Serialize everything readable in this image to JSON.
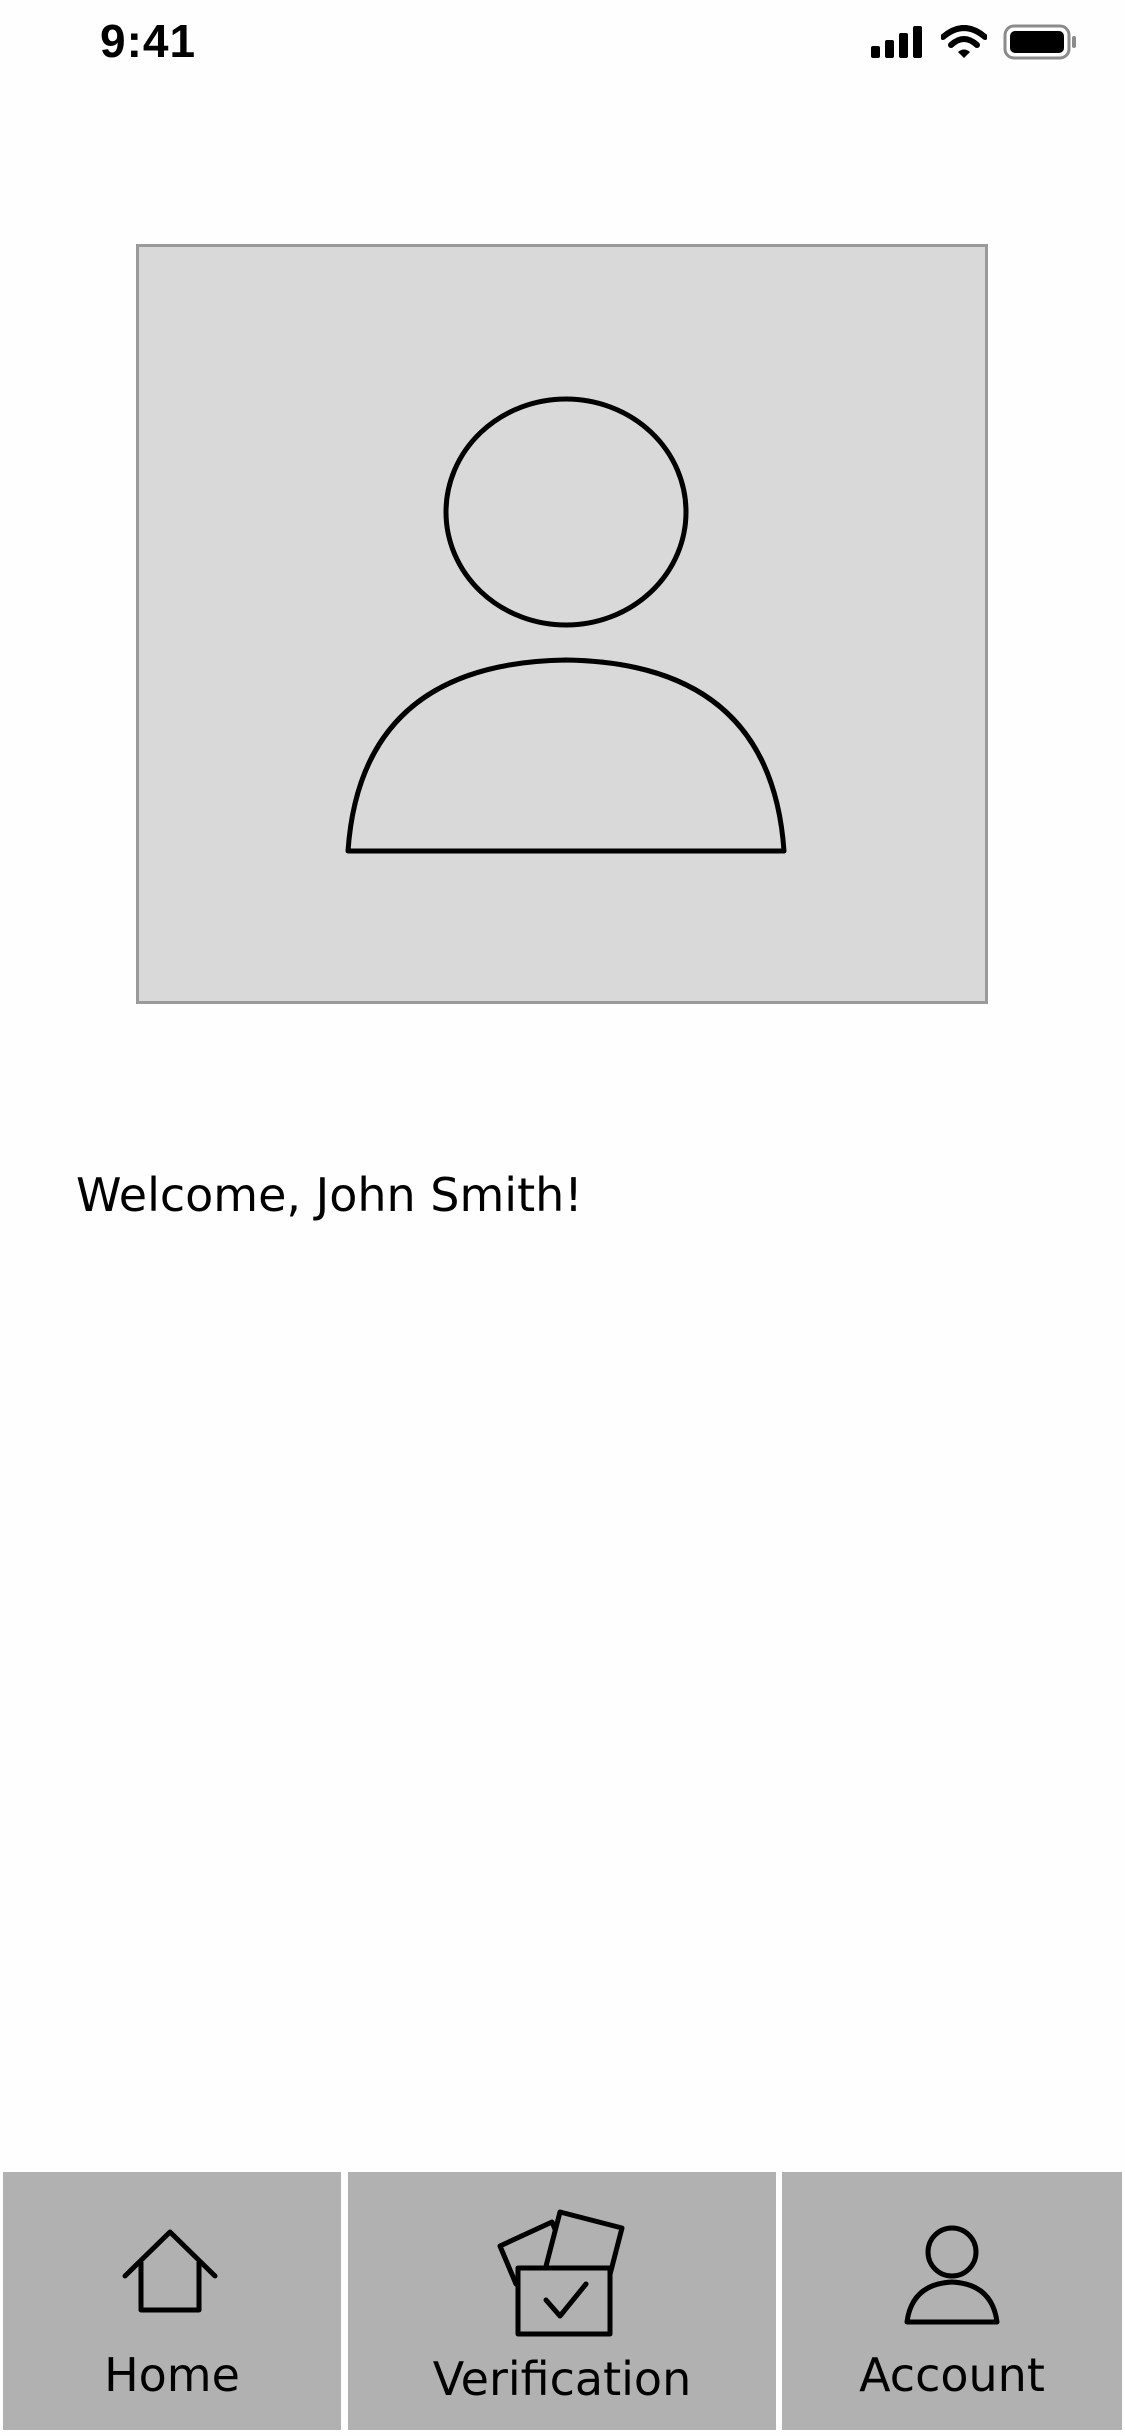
{
  "status_bar": {
    "time": "9:41",
    "icons": [
      "cellular-signal-icon",
      "wifi-icon",
      "battery-icon"
    ]
  },
  "profile": {
    "photo_placeholder_icon": "person-icon",
    "welcome_text": "Welcome, John Smith!"
  },
  "tab_bar": {
    "tabs": [
      {
        "label": "Home",
        "icon": "house-icon"
      },
      {
        "label": "Verification",
        "icon": "verification-cards-icon"
      },
      {
        "label": "Account",
        "icon": "person-icon"
      }
    ],
    "background_color": "#b1b1b1"
  },
  "colors": {
    "placeholder_fill": "#d9d9d9",
    "placeholder_border": "#9a9a9a",
    "page_background": "#fefefe"
  }
}
